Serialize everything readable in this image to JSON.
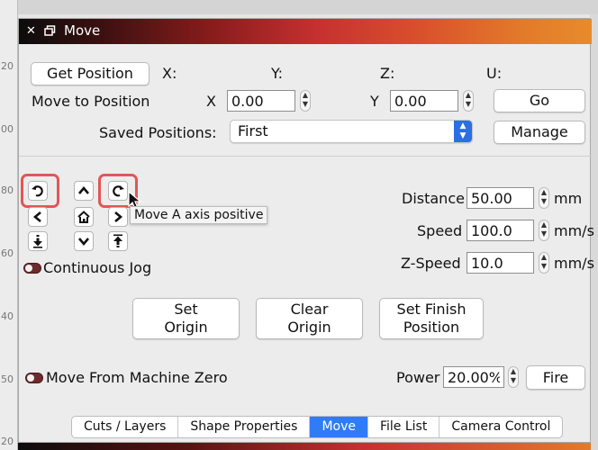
{
  "window": {
    "title": "Move"
  },
  "ruler": {
    "ticks": [
      "20",
      "00",
      "80",
      "60",
      "40",
      "50",
      "20"
    ]
  },
  "position": {
    "get_label": "Get Position",
    "axis_labels": [
      "X:",
      "Y:",
      "Z:",
      "U:"
    ],
    "move_to_label": "Move to Position",
    "x_label": "X",
    "x_value": "0.00",
    "y_label": "Y",
    "y_value": "0.00",
    "go_label": "Go",
    "saved_label": "Saved Positions:",
    "saved_value": "First",
    "manage_label": "Manage"
  },
  "jog": {
    "tooltip": "Move A axis positive",
    "continuous_label": "Continuous Jog"
  },
  "settings": {
    "distance_label": "Distance",
    "distance_value": "50.00",
    "distance_unit": "mm",
    "speed_label": "Speed",
    "speed_value": "100.0",
    "speed_unit": "mm/s",
    "zspeed_label": "Z-Speed",
    "zspeed_value": "10.0",
    "zspeed_unit": "mm/s"
  },
  "actions": {
    "set_origin": [
      "Set",
      "Origin"
    ],
    "clear_origin": [
      "Clear",
      "Origin"
    ],
    "set_finish": [
      "Set Finish",
      "Position"
    ]
  },
  "fire": {
    "machine_zero_label": "Move From Machine Zero",
    "power_label": "Power",
    "power_value": "20.00%",
    "fire_label": "Fire"
  },
  "tabs": [
    {
      "label": "Cuts / Layers",
      "active": false
    },
    {
      "label": "Shape Properties",
      "active": false
    },
    {
      "label": "Move",
      "active": true
    },
    {
      "label": "File List",
      "active": false
    },
    {
      "label": "Camera Control",
      "active": false
    }
  ],
  "colors": {
    "accent": "#2f7cf6",
    "highlight": "#e25656",
    "toggle": "#6e2b2b"
  }
}
